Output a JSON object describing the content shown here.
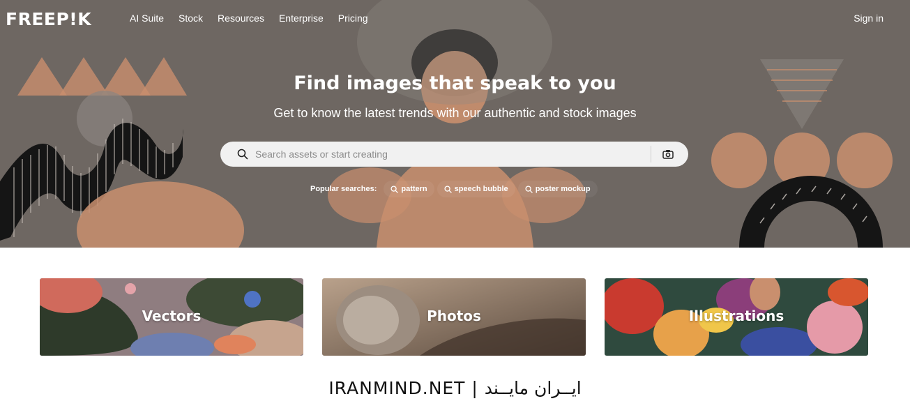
{
  "header": {
    "logo": "FREEP!K",
    "nav": [
      "AI Suite",
      "Stock",
      "Resources",
      "Enterprise",
      "Pricing"
    ],
    "sign_in": "Sign in"
  },
  "hero": {
    "title": "Find images that speak to you",
    "subtitle": "Get to know the latest trends with our authentic and stock images",
    "search": {
      "placeholder": "Search assets or start creating",
      "value": ""
    },
    "popular_label": "Popular searches:",
    "popular": [
      "pattern",
      "speech bubble",
      "poster mockup"
    ]
  },
  "categories": [
    "Vectors",
    "Photos",
    "Illustrations"
  ],
  "watermark": "IRANMIND.NET | ایــران مایــند",
  "colors": {
    "hero_bg": "#6e6762",
    "accent_peach": "#e8a27c",
    "search_bg": "#f1f1f1"
  }
}
